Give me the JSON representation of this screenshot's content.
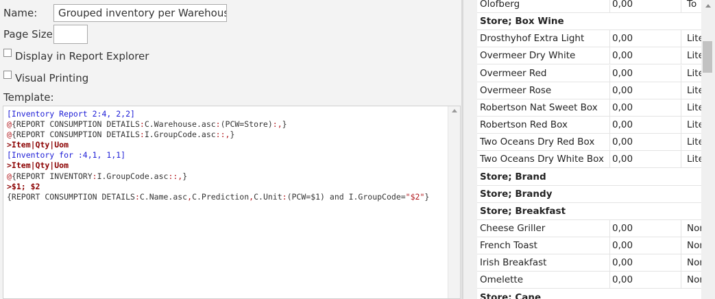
{
  "form": {
    "name_label": "Name:",
    "name_value": "Grouped inventory per Warehouse",
    "page_size_label": "Page Size:",
    "page_size_value": "",
    "display_in_explorer_label": "Display in Report Explorer",
    "display_in_explorer_checked": false,
    "visual_printing_label": "Visual Printing",
    "visual_printing_checked": false,
    "template_label": "Template:"
  },
  "template_lines": [
    [
      {
        "t": "[Inventory Report 2:4, 2,2]",
        "c": "c-blue"
      }
    ],
    [
      {
        "t": "@",
        "c": "c-red"
      },
      {
        "t": "{REPORT CONSUMPTION DETAILS",
        "c": "c-dark"
      },
      {
        "t": ":",
        "c": "c-red"
      },
      {
        "t": "C.Warehouse.asc",
        "c": "c-dark"
      },
      {
        "t": ":",
        "c": "c-red"
      },
      {
        "t": "(PCW=Store)",
        "c": "c-dark"
      },
      {
        "t": ":,",
        "c": "c-red"
      },
      {
        "t": "}",
        "c": "c-dark"
      }
    ],
    [
      {
        "t": "@",
        "c": "c-red"
      },
      {
        "t": "{REPORT CONSUMPTION DETAILS",
        "c": "c-dark"
      },
      {
        "t": ":",
        "c": "c-red"
      },
      {
        "t": "I.GroupCode.asc",
        "c": "c-dark"
      },
      {
        "t": "::,",
        "c": "c-red"
      },
      {
        "t": "}",
        "c": "c-dark"
      }
    ],
    [
      {
        "t": ">Item|Qty|Uom",
        "c": "c-bred"
      }
    ],
    [
      {
        "t": "[Inventory for :4,1, 1,1]",
        "c": "c-blue"
      }
    ],
    [
      {
        "t": ">Item|Qty|Uom",
        "c": "c-bred"
      }
    ],
    [
      {
        "t": "@",
        "c": "c-red"
      },
      {
        "t": "{REPORT INVENTORY",
        "c": "c-dark"
      },
      {
        "t": ":",
        "c": "c-red"
      },
      {
        "t": "I.GroupCode.asc",
        "c": "c-dark"
      },
      {
        "t": "::,",
        "c": "c-red"
      },
      {
        "t": "}",
        "c": "c-dark"
      }
    ],
    [
      {
        "t": ">$1; $2",
        "c": "c-bred"
      }
    ],
    [
      {
        "t": "{REPORT CONSUMPTION DETAILS",
        "c": "c-dark"
      },
      {
        "t": ":",
        "c": "c-red"
      },
      {
        "t": "C.Name.asc",
        "c": "c-dark"
      },
      {
        "t": ",",
        "c": "c-red"
      },
      {
        "t": "C.Prediction",
        "c": "c-dark"
      },
      {
        "t": ",",
        "c": "c-red"
      },
      {
        "t": "C.Unit",
        "c": "c-dark"
      },
      {
        "t": ":",
        "c": "c-red"
      },
      {
        "t": "(PCW=$1) and I.GroupCode=",
        "c": "c-dark"
      },
      {
        "t": "\"$2\"",
        "c": "c-red"
      },
      {
        "t": "}",
        "c": "c-dark"
      }
    ]
  ],
  "preview_rows": [
    {
      "type": "item",
      "name": "Olofberg",
      "qty": "0,00",
      "uom": "To"
    },
    {
      "type": "group",
      "name": "Store; Box Wine"
    },
    {
      "type": "item",
      "name": "Drosthyhof Extra Light",
      "qty": "0,00",
      "uom": "Lite"
    },
    {
      "type": "item",
      "name": "Overmeer Dry White",
      "qty": "0,00",
      "uom": "Lite"
    },
    {
      "type": "item",
      "name": "Overmeer Red",
      "qty": "0,00",
      "uom": "Lite"
    },
    {
      "type": "item",
      "name": "Overmeer Rose",
      "qty": "0,00",
      "uom": "Lite"
    },
    {
      "type": "item",
      "name": "Robertson Nat Sweet Box",
      "qty": "0,00",
      "uom": "Lite"
    },
    {
      "type": "item",
      "name": "Robertson Red Box",
      "qty": "0,00",
      "uom": "Lite"
    },
    {
      "type": "item",
      "name": "Two Oceans Dry Red Box",
      "qty": "0,00",
      "uom": "Lite"
    },
    {
      "type": "item",
      "name": "Two Oceans Dry White Box",
      "qty": "0,00",
      "uom": "Lite"
    },
    {
      "type": "group",
      "name": "Store; Brand"
    },
    {
      "type": "group",
      "name": "Store; Brandy"
    },
    {
      "type": "group",
      "name": "Store; Breakfast"
    },
    {
      "type": "item",
      "name": "Cheese Griller",
      "qty": "0,00",
      "uom": "Norma"
    },
    {
      "type": "item",
      "name": "French Toast",
      "qty": "0,00",
      "uom": "Norma"
    },
    {
      "type": "item",
      "name": "Irish Breakfast",
      "qty": "0,00",
      "uom": "Norma"
    },
    {
      "type": "item",
      "name": "Omelette",
      "qty": "0,00",
      "uom": "Norma"
    },
    {
      "type": "group",
      "name": "Store; Cane"
    }
  ]
}
